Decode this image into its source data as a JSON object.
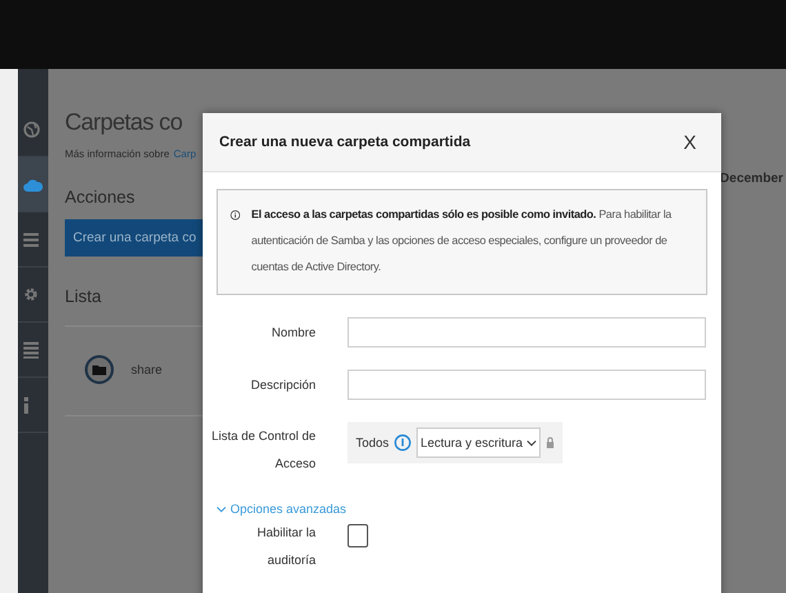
{
  "sidebar": {
    "items": [
      {
        "kind": "globe",
        "selected": false
      },
      {
        "kind": "cloud",
        "selected": true
      },
      {
        "kind": "menu",
        "selected": false
      },
      {
        "kind": "gear",
        "selected": false
      },
      {
        "kind": "table",
        "selected": false
      },
      {
        "kind": "info",
        "selected": false
      }
    ]
  },
  "page": {
    "title": "Carpetas co",
    "intro": "Más información sobre",
    "intro_link": "Carp",
    "actions_heading": "Acciones",
    "create_button": "Crear una carpeta co",
    "list_heading": "Lista",
    "shares": [
      {
        "name": "share"
      }
    ],
    "date": "December"
  },
  "dialog": {
    "title": "Crear una nueva carpeta compartida",
    "close": "X",
    "notice": "**El acceso a las carpetas compartidas sólo es posible como invitado.** Para habilitar la autenticación de Samba y las opciones de acceso especiales, configure un proveedor de cuentas de Active Directory.",
    "fields": [
      {
        "label": "Nombre"
      },
      {
        "label": "Descripción"
      }
    ],
    "acl": {
      "label": "Lista de Control de Acceso",
      "group": "Todos",
      "permission": "Lectura y escritura"
    },
    "advanced": {
      "label": "Opciones avanzadas",
      "expanded": true
    },
    "audit": {
      "label": "Habilitar la auditoría",
      "checked": false
    }
  }
}
